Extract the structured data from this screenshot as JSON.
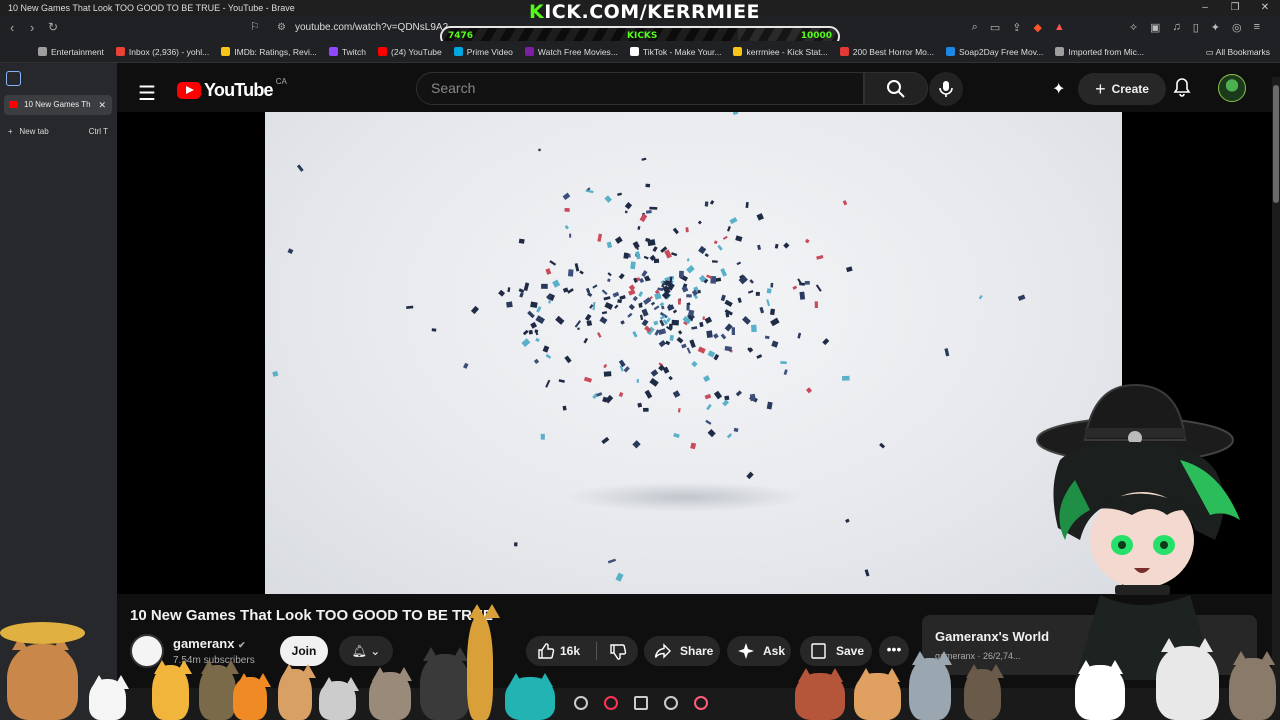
{
  "window": {
    "title": "10 New Games That Look TOO GOOD TO BE TRUE - YouTube - Brave",
    "controls": [
      "–",
      "❐",
      "✕"
    ]
  },
  "stream_overlay": {
    "kick_brand": "KICK.COM/KERRMIEE",
    "kick_brand_first": "K",
    "kick_brand_rest": "ICK.COM/KERRMIEE",
    "kicks_current": "7476",
    "kicks_label": "KICKS",
    "kicks_goal": "10000",
    "kicks_progress": 0.7476
  },
  "browser": {
    "url": "youtube.com/watch?v=QDNsL9A2...",
    "bookmarks": [
      {
        "label": "Entertainment",
        "color": "#9e9e9e"
      },
      {
        "label": "Inbox (2,936) - yohl...",
        "color": "#ea4335"
      },
      {
        "label": "IMDb: Ratings, Revi...",
        "color": "#f5c518"
      },
      {
        "label": "Twitch",
        "color": "#9146ff"
      },
      {
        "label": "(24) YouTube",
        "color": "#ff0000"
      },
      {
        "label": "Prime Video",
        "color": "#00a8e1"
      },
      {
        "label": "Watch Free Movies...",
        "color": "#7b1fa2"
      },
      {
        "label": "TikTok - Make Your...",
        "color": "#ffffff"
      },
      {
        "label": "kerrmiee - Kick Stat...",
        "color": "#f5c518"
      },
      {
        "label": "200 Best Horror Mo...",
        "color": "#e53935"
      },
      {
        "label": "Soap2Day Free Mov...",
        "color": "#1e88e5"
      },
      {
        "label": "Imported from Mic...",
        "color": "#9e9e9e"
      }
    ],
    "all_bookmarks": "All Bookmarks",
    "tabs": [
      {
        "label": "10 New Games Th",
        "active": true
      }
    ],
    "new_tab": "New tab",
    "new_tab_shortcut": "Ctrl T"
  },
  "youtube": {
    "logo_text": "YouTube",
    "country": "CA",
    "search_placeholder": "Search",
    "create_label": "Create",
    "video": {
      "title": "10 New Games That Look TOO GOOD TO BE TRUE",
      "channel": "gameranx",
      "subscribers": "7.54m subscribers",
      "join_label": "Join",
      "likes": "16k",
      "share_label": "Share",
      "ask_label": "Ask",
      "save_label": "Save"
    },
    "recommendation": {
      "title": "Gameranx's World",
      "meta": "gameranx · 26/2,74..."
    }
  },
  "colors": {
    "kick_green": "#53fc18",
    "youtube_red": "#ff0000",
    "background": "#0f0f0f"
  }
}
